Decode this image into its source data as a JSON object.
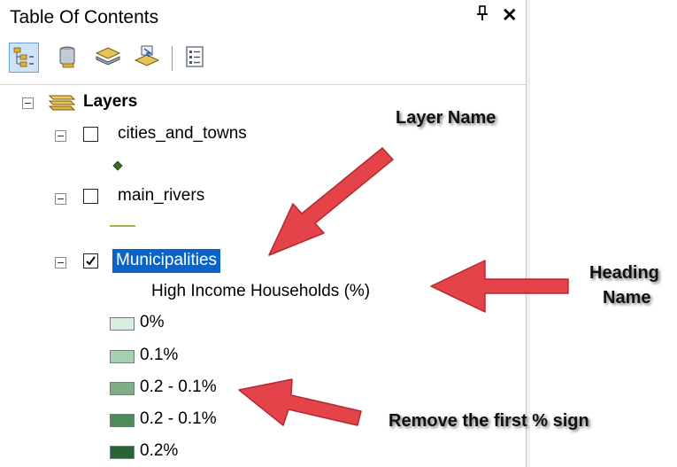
{
  "panel": {
    "title": "Table Of Contents",
    "pin_icon": "pin-icon",
    "close_label": "✕"
  },
  "toolbar": {
    "buttons": [
      {
        "icon": "list-by-drawing-order-icon",
        "active": true
      },
      {
        "icon": "list-by-source-icon",
        "active": false
      },
      {
        "icon": "list-by-visibility-icon",
        "active": false
      },
      {
        "icon": "list-by-selection-icon",
        "active": false
      },
      {
        "icon": "options-icon",
        "active": false
      }
    ]
  },
  "tree": {
    "root_label": "Layers",
    "layers": [
      {
        "name": "cities_and_towns",
        "checked": false,
        "symbol": "point",
        "symbol_color": "#3a6b1e"
      },
      {
        "name": "main_rivers",
        "checked": false,
        "symbol": "line",
        "symbol_color": "#a8b44a"
      },
      {
        "name": "Municipalities",
        "checked": true,
        "selected": true,
        "heading": "High Income Households (%)",
        "classes": [
          {
            "label": "0%",
            "color": "#d8efe0"
          },
          {
            "label": "0.1%",
            "color": "#a6d1b0"
          },
          {
            "label": "0.2 - 0.1%",
            "color": "#7dae85"
          },
          {
            "label": "0.2 - 0.1%",
            "color": "#4e8a5a"
          },
          {
            "label": "0.2%",
            "color": "#2a6335"
          }
        ]
      }
    ]
  },
  "annotations": {
    "layer_name": "Layer Name",
    "heading_name_line1": "Heading",
    "heading_name_line2": "Name",
    "remove_sign": "Remove the first % sign",
    "arrow_color": "#e5434a"
  }
}
